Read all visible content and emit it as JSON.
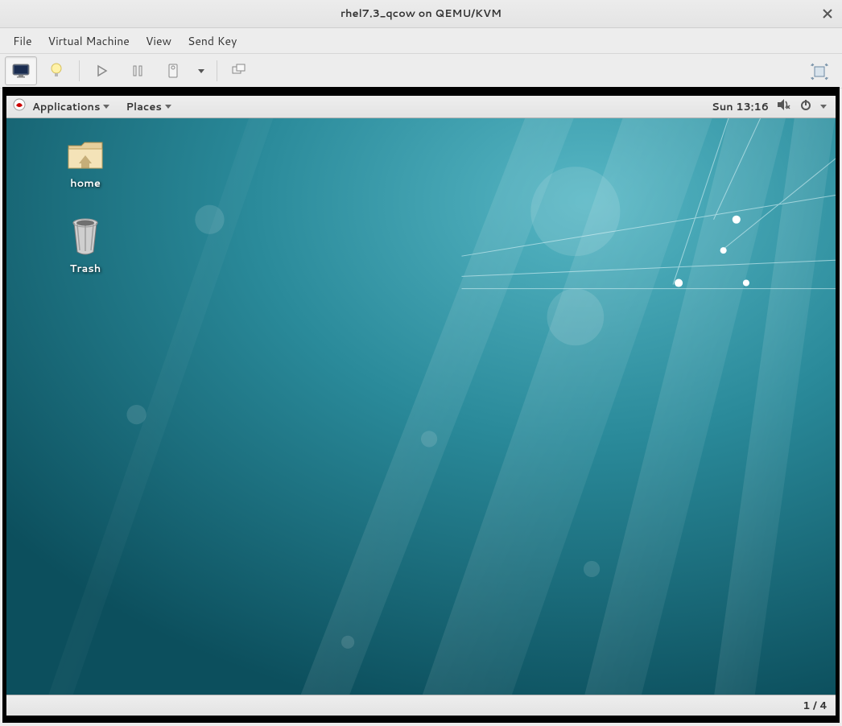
{
  "window": {
    "title": "rhel7.3_qcow on QEMU/KVM"
  },
  "menubar": {
    "items": [
      "File",
      "Virtual Machine",
      "View",
      "Send Key"
    ]
  },
  "guest": {
    "topbar": {
      "applications": "Applications",
      "places": "Places",
      "clock": "Sun 13:16"
    },
    "desktop_icons": {
      "home": "home",
      "trash": "Trash"
    },
    "bottombar": {
      "workspace": "1 / 4"
    }
  }
}
